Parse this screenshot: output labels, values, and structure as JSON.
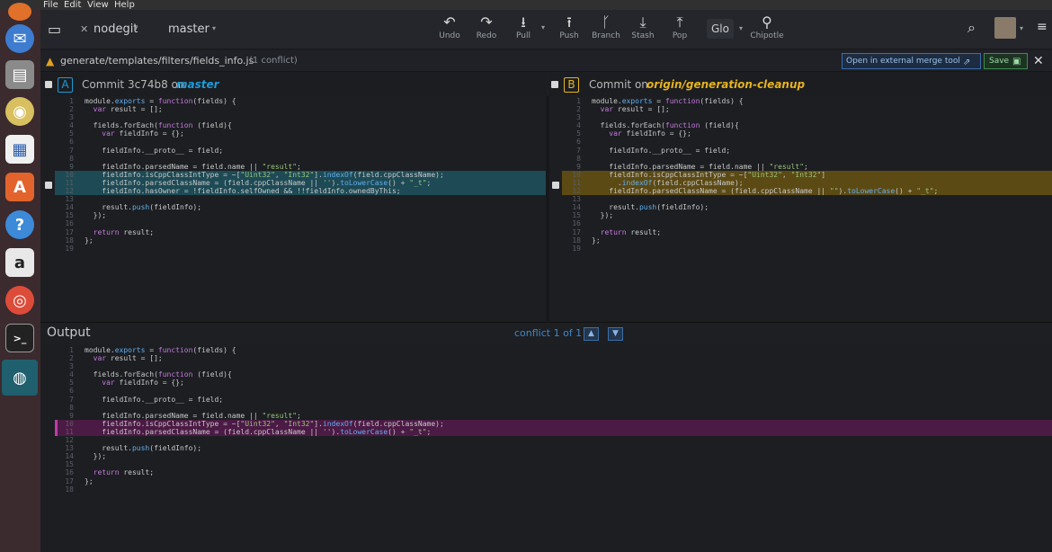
{
  "os_menu": {
    "items": [
      "File",
      "Edit",
      "View",
      "Help"
    ]
  },
  "toolbar": {
    "repo": "nodegit",
    "branch": "master",
    "actions": [
      {
        "label": "Undo",
        "icon": "↶"
      },
      {
        "label": "Redo",
        "icon": "↷"
      },
      {
        "label": "Pull",
        "icon": "⭳"
      },
      {
        "label": "Push",
        "icon": "⭱"
      },
      {
        "label": "Branch",
        "icon": "ᚴ"
      },
      {
        "label": "Stash",
        "icon": "⤓"
      },
      {
        "label": "Pop",
        "icon": "⤒"
      }
    ],
    "glo": "Glo",
    "profile": "Chipotle"
  },
  "file": {
    "path": "generate/templates/filters/fields_info.js",
    "conflict_count": "(1 conflict)",
    "open_external": "Open in external merge tool",
    "save": "Save"
  },
  "panel_a": {
    "letter": "A",
    "prefix": "Commit 3c74b8 on",
    "ref": "master"
  },
  "panel_b": {
    "letter": "B",
    "prefix": "Commit on",
    "ref": "origin/generation-cleanup"
  },
  "output": {
    "title": "Output",
    "conflict_nav": "conflict 1 of 1"
  },
  "code_a": [
    "module.exports = function(fields) {",
    "  var result = [];",
    "",
    "  fields.forEach(function (field){",
    "    var fieldInfo = {};",
    "",
    "    fieldInfo.__proto__ = field;",
    "",
    "    fieldInfo.parsedName = field.name || \"result\";",
    "    fieldInfo.isCppClassIntType = ~[\"Uint32\", \"Int32\"].indexOf(field.cppClassName);",
    "    fieldInfo.parsedClassName = (field.cppClassName || '').toLowerCase() + \"_t\";",
    "    fieldInfo.hasOwner = !fieldInfo.selfOwned && !!fieldInfo.ownedByThis;",
    "",
    "    result.push(fieldInfo);",
    "  });",
    "",
    "  return result;",
    "};",
    ""
  ],
  "code_b": [
    "module.exports = function(fields) {",
    "  var result = [];",
    "",
    "  fields.forEach(function (field){",
    "    var fieldInfo = {};",
    "",
    "    fieldInfo.__proto__ = field;",
    "",
    "    fieldInfo.parsedName = field.name || \"result\";",
    "    fieldInfo.isCppClassIntType = ~[\"Uint32\", \"Int32\"]",
    "      .indexOf(field.cppClassName);",
    "    fieldInfo.parsedClassName = (field.cppClassName || \"\").toLowerCase() + \"_t\";",
    "",
    "    result.push(fieldInfo);",
    "  });",
    "",
    "  return result;",
    "};",
    ""
  ],
  "code_out": [
    "module.exports = function(fields) {",
    "  var result = [];",
    "",
    "  fields.forEach(function (field){",
    "    var fieldInfo = {};",
    "",
    "    fieldInfo.__proto__ = field;",
    "",
    "    fieldInfo.parsedName = field.name || \"result\";",
    "    fieldInfo.isCppClassIntType = ~[\"Uint32\", \"Int32\"].indexOf(field.cppClassName);",
    "    fieldInfo.parsedClassName = (field.cppClassName || '').toLowerCase() + \"_t\";",
    "",
    "    result.push(fieldInfo);",
    "  });",
    "",
    "  return result;",
    "};",
    ""
  ],
  "colors": {
    "accent_a": "#1e9bd7",
    "accent_b": "#e6b320",
    "output_conflict": "#8a2f80"
  }
}
